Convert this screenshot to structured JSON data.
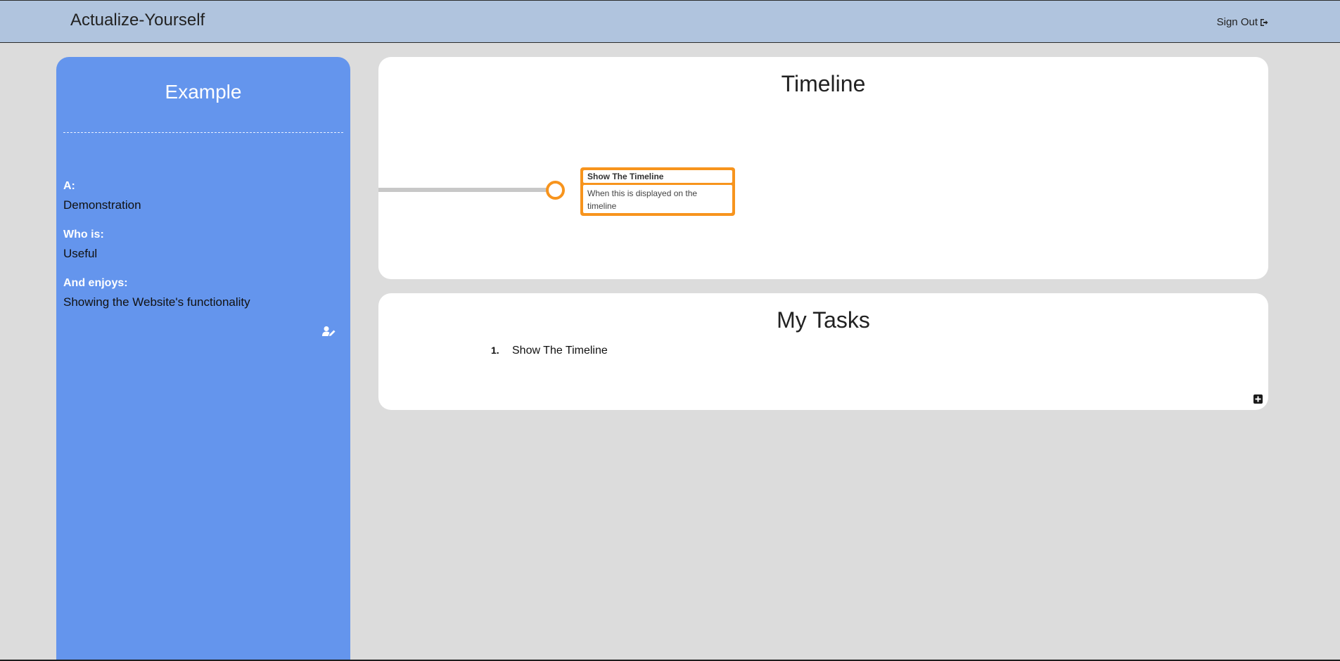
{
  "navbar": {
    "brand": "Actualize-Yourself",
    "sign_out_label": "Sign Out"
  },
  "sidebar": {
    "title": "Example",
    "fields": [
      {
        "label": "A:",
        "value": "Demonstration"
      },
      {
        "label": "Who is:",
        "value": "Useful"
      },
      {
        "label": "And enjoys:",
        "value": "Showing the Website's functionality"
      }
    ]
  },
  "timeline": {
    "title": "Timeline",
    "events": [
      {
        "title": "Show The Timeline",
        "description": "When this is displayed on the timeline"
      }
    ]
  },
  "tasks": {
    "title": "My Tasks",
    "items": [
      {
        "number": "1.",
        "label": "Show The Timeline"
      }
    ]
  },
  "colors": {
    "navbar": "#b0c4de",
    "sidebar": "#6495ed",
    "timeline_accent": "#f7941d",
    "background": "#dcdcdc"
  },
  "icons": {
    "sign_out": "sign-out-icon",
    "edit_profile": "user-edit-icon",
    "add_task": "plus-square-icon"
  }
}
